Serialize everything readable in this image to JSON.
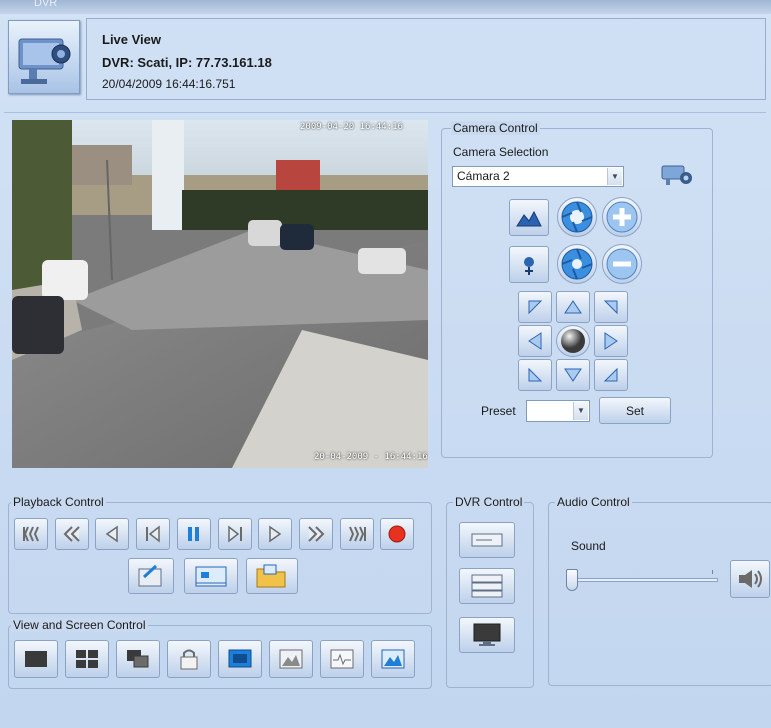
{
  "app": {
    "window_title": "DVR"
  },
  "header": {
    "title": "Live View",
    "dvr_info": "DVR: Scati, IP: 77.73.161.18",
    "datetime": "20/04/2009 16:44:16.751"
  },
  "video": {
    "overlay_top_left": "",
    "overlay_top_right": "2009-04-20 16:44:16",
    "overlay_bottom_right": "20-04-2009 - 16:44:16"
  },
  "camera_control": {
    "legend": "Camera Control",
    "selection_label": "Camera Selection",
    "selected_camera": "Cámara 2",
    "preset_label": "Preset",
    "preset_value": "",
    "set_button": "Set"
  },
  "playback_control": {
    "legend": "Playback Control"
  },
  "view_control": {
    "legend": "View and Screen Control"
  },
  "dvr_control": {
    "legend": "DVR Control"
  },
  "audio_control": {
    "legend": "Audio Control",
    "sound_label": "Sound",
    "volume_level": 0.0
  },
  "colors": {
    "background": "#c9daf0",
    "button_blue": "#1f7fd6",
    "record_red": "#e8321f"
  }
}
